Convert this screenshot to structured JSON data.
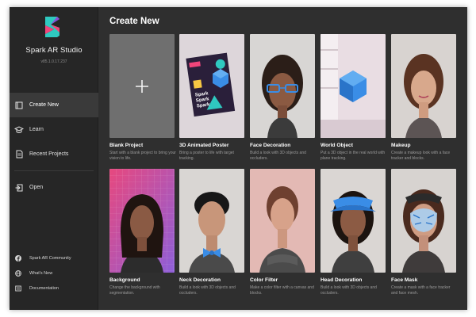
{
  "app": {
    "name": "Spark AR Studio",
    "version": "v85.1.0.17.237"
  },
  "nav": [
    {
      "label": "Create New",
      "icon": "create-new-icon"
    },
    {
      "label": "Learn",
      "icon": "learn-icon"
    },
    {
      "label": "Recent Projects",
      "icon": "recent-projects-icon"
    },
    {
      "label": "Open",
      "icon": "open-icon"
    }
  ],
  "footer": [
    {
      "label": "Spark AR Community",
      "icon": "facebook-icon"
    },
    {
      "label": "What's New",
      "icon": "globe-icon"
    },
    {
      "label": "Documentation",
      "icon": "documentation-icon"
    }
  ],
  "main": {
    "title": "Create New"
  },
  "templates": [
    {
      "title": "Blank Project",
      "desc": "Start with a blank project to bring your vision to life."
    },
    {
      "title": "3D Animated Poster",
      "desc": "Bring a poster to life with target tracking."
    },
    {
      "title": "Face Decoration",
      "desc": "Build a look with 3D objects and occluders."
    },
    {
      "title": "World Object",
      "desc": "Put a 3D object in the real world with plane tracking."
    },
    {
      "title": "Makeup",
      "desc": "Create a makeup look with a face tracker and blocks."
    },
    {
      "title": "Background",
      "desc": "Change the background with segmentation."
    },
    {
      "title": "Neck Decoration",
      "desc": "Build a look with 3D objects and occluders."
    },
    {
      "title": "Color Filter",
      "desc": "Make a color filter with a canvas and blocks."
    },
    {
      "title": "Head Decoration",
      "desc": "Build a look with 3D objects and occluders."
    },
    {
      "title": "Face Mask",
      "desc": "Create a mask with a face tracker and face mesh."
    }
  ],
  "poster": {
    "line1": "Spark",
    "line2": "Spark",
    "line3": "Spark"
  },
  "colors": {
    "accent_pink": "#f0457a",
    "accent_teal": "#2fc9c0",
    "blue": "#3a8de6"
  }
}
